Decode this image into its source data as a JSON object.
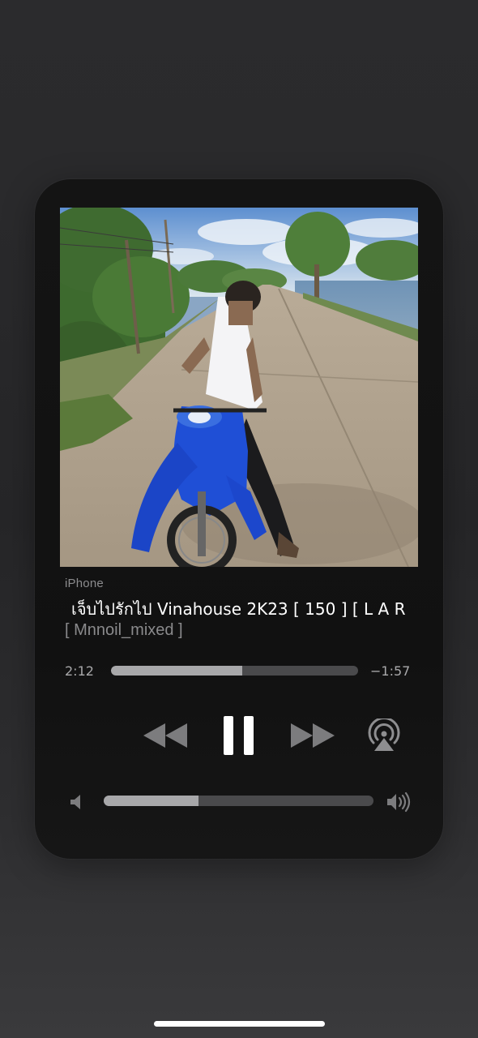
{
  "now_playing": {
    "device": "iPhone",
    "title": "เจ็บไปรักไป Vinahouse 2K23 [ 150 ] [ L A R",
    "artist": "[ Mnnoil_mixed ]",
    "elapsed": "2:12",
    "remaining": "−1:57",
    "progress_fraction": 0.53,
    "artwork": "photo of a boy sitting on a blue motorbike on a concrete road beside a lake"
  },
  "controls": {
    "rewind_icon": "rewind-icon",
    "pause_icon": "pause-icon",
    "forward_icon": "fast-forward-icon",
    "airplay_icon": "airplay-audio-icon"
  },
  "volume": {
    "level_fraction": 0.35,
    "low_icon": "speaker-low-icon",
    "high_icon": "speaker-high-icon"
  },
  "colors": {
    "card_background": "#121212",
    "primary_text": "#ffffff",
    "secondary_text": "#8a8a8c",
    "track_background": "#4a4a4c",
    "track_fill": "#a8a8aa"
  }
}
